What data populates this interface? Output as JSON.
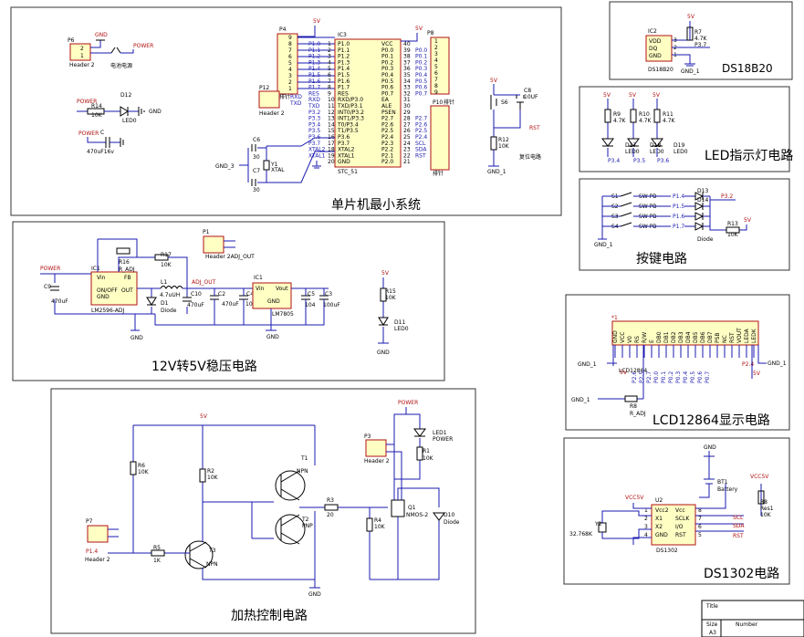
{
  "sections": {
    "mcu": "单片机最小系统",
    "reg": "12V转5V稳压电路",
    "heat": "加热控制电路",
    "ds18": "DS18B20",
    "led": "LED指示灯电路",
    "key": "按键电路",
    "lcd": "LCD12864显示电路",
    "rtc": "DS1302电路"
  },
  "power": {
    "conn": "P6",
    "hdr": "Header 2",
    "gnd": "GND",
    "pwr": "POWER",
    "sw": "电池电源",
    "r": "R14",
    "rv": "10K",
    "led": "D12",
    "ledv": "LED0",
    "cap": "470uF16v",
    "p1": "2",
    "p2": "1"
  },
  "mcu": {
    "ic": "IC3",
    "part": "STC_51",
    "left_names": [
      "P1.0",
      "P1.1",
      "P1.2",
      "P1.3",
      "P1.4",
      "P1.5",
      "P1.6",
      "P1.7",
      "RES",
      "RXD/P3.0",
      "TXD/P3.1",
      "INT0/P3.2",
      "INT1/P3.3",
      "T0/P3.4",
      "T1/P3.5",
      "P3.6",
      "P3.7",
      "XTAL2",
      "XTAL1",
      "GND"
    ],
    "left_pins": [
      "1",
      "2",
      "3",
      "4",
      "5",
      "6",
      "7",
      "8",
      "9",
      "10",
      "11",
      "12",
      "13",
      "14",
      "15",
      "16",
      "17",
      "18",
      "19",
      "20"
    ],
    "left_nets": [
      "P1.0",
      "P1.1",
      "P1.2",
      "P1.3",
      "P1.4",
      "P1.5",
      "P1.6",
      "P1.7",
      "RES",
      "RXD",
      "TXD",
      "P3.2",
      "P3.3",
      "P3.4",
      "P3.5",
      "P3.6",
      "P3.7",
      "XTAL2",
      "XTAL1"
    ],
    "right_names": [
      "VCC",
      "P0.0",
      "P0.1",
      "P0.2",
      "P0.3",
      "P0.4",
      "P0.5",
      "P0.6",
      "P0.7",
      "EA",
      "ALE",
      "PSEN",
      "P2.7",
      "P2.6",
      "P2.5",
      "P2.4",
      "P2.3",
      "P2.2",
      "P2.1",
      "P2.0"
    ],
    "right_pins": [
      "40",
      "39",
      "38",
      "37",
      "36",
      "35",
      "34",
      "33",
      "32",
      "31",
      "30",
      "29",
      "28",
      "27",
      "26",
      "25",
      "24",
      "23",
      "22",
      "21"
    ],
    "right_nets": [
      "P0.0",
      "P0.1",
      "P0.2",
      "P0.3",
      "P0.4",
      "P0.5",
      "P0.6",
      "P0.7",
      "P2.7",
      "P2.6",
      "P2.5",
      "P2.4",
      "SCL",
      "SDA",
      "RST"
    ],
    "p4": "P4",
    "p4_nums": [
      "9",
      "8",
      "7",
      "6",
      "5",
      "4",
      "3",
      "2",
      "1"
    ],
    "p12": "P12",
    "p12_hdr": "Header 2",
    "p12_nets": [
      "RXD",
      "TXD"
    ],
    "p12_lbl": "排针",
    "p8": "P8",
    "p8_nums": [
      "1",
      "2",
      "3",
      "4",
      "5",
      "6",
      "7",
      "8",
      "9"
    ],
    "p10": "P10",
    "p10_lbl": "排针",
    "p10_lbl2": "排针",
    "v5": "5V",
    "c6": "C6",
    "c7": "C7",
    "c30a": "30",
    "c30b": "30",
    "y1": "Y1",
    "xtal": "XTAL",
    "gnd3": "GND_3",
    "s6": "S6",
    "c8": "C8",
    "c8v": "10UF",
    "r12": "R12",
    "r12v": "10K",
    "rst": "RST",
    "gnd1": "GND_1",
    "rstlbl": "复位电路"
  },
  "ds18": {
    "ic": "IC2",
    "pins": [
      "VDD",
      "DQ",
      "GND"
    ],
    "pnum": [
      "3",
      "2",
      "1"
    ],
    "r": "R7",
    "rv": "4.7K",
    "net": "P3.7",
    "v": "5V",
    "part": "DS18B20",
    "gnd": "GND_1"
  },
  "leds": {
    "r": [
      "R9",
      "R10",
      "R11"
    ],
    "rv": [
      "4.7K",
      "4.7K",
      "4.7K"
    ],
    "v": "5V",
    "d": [
      "D17",
      "D18",
      "D19"
    ],
    "dv": [
      "LED0",
      "LED0",
      "LED0"
    ],
    "nets": [
      "P3.4",
      "P3.5",
      "P3.6"
    ]
  },
  "keys": {
    "s": [
      "S1",
      "S2",
      "S3",
      "S4"
    ],
    "sv": "SW-PB",
    "nets": [
      "P1.4",
      "P1.5",
      "P1.6",
      "P1.7"
    ],
    "d13": "D13",
    "d14": "D14",
    "dv": "Diode",
    "p32": "P3.2",
    "r13": "R13",
    "r13v": "10K",
    "v": "5V",
    "gnd": "GND_1"
  },
  "lcd": {
    "star": "*1",
    "pins": [
      "GND",
      "VCC",
      "V0",
      "RS",
      "R/W",
      "E",
      "DB0",
      "DB1",
      "DB2",
      "DB3",
      "DB4",
      "DB5",
      "DB6",
      "DB7",
      "PSB",
      "NC",
      "RST",
      "VOUT",
      "LEDA",
      "LEDK"
    ],
    "nets": [
      "P2.6",
      "P2.5",
      "P2.7",
      "P0.0",
      "P0.1",
      "P0.2",
      "P0.3",
      "P0.4",
      "P0.5",
      "P0.6",
      "P0.7"
    ],
    "lcdlbl": "LCD12864",
    "v5": "5V",
    "gnd": "GND_1",
    "r8": "R8",
    "radj": "R_ADJ",
    "p24": "P2.4",
    "psb": "PSB",
    "rst": "RST",
    "nc": "NC"
  },
  "rtc": {
    "gnd": "GND",
    "bt": "BT1",
    "btv": "Battery",
    "vcc": "VCC5V",
    "pins_l": [
      "Vcc2",
      "X1",
      "X2",
      "GND"
    ],
    "pins_r": [
      "Vcc",
      "SCLK",
      "I/O",
      "RST"
    ],
    "pnum_l": [
      "1",
      "2",
      "3",
      "4"
    ],
    "pnum_r": [
      "8",
      "7",
      "6",
      "5"
    ],
    "nets": [
      "SCL",
      "SDA",
      "RST"
    ],
    "part": "DS1302",
    "ic": "U2",
    "y2": "Y2",
    "y2v": "32.768K",
    "r8": "R8",
    "r8v": "Res1",
    "r8k": "10K",
    "vcc2": "VCC5V"
  },
  "reg": {
    "pwr": "POWER",
    "c9": "C9",
    "c9v": "470uF",
    "ic": "IC1",
    "part": "LM2596-ADJ",
    "pins_l": [
      "Vin",
      "ON/OFF",
      "GND"
    ],
    "pins_r": [
      "FB",
      "OUT"
    ],
    "r16": "R16",
    "radj": "R_ADJ",
    "r17": "R17",
    "r17v": "10K",
    "l1": "L1",
    "l1v": "4.7uUH",
    "d1": "D1",
    "d1v": "Diode",
    "c10": "C10",
    "c10v": "470uF",
    "adj": "ADJ_OUT",
    "p1": "P1",
    "p1h": "Header 2ADJ_OUT",
    "c2": "C2",
    "c2v": "470uF",
    "c4": "C4",
    "c4v": "104",
    "ic2": "IC1",
    "vin": "Vin",
    "vout": "Vout",
    "gnd": "GND",
    "part2": "LM7805",
    "c5": "C5",
    "c5v": "104",
    "c3": "C3",
    "c3v": "100uF",
    "r15": "R15",
    "r15v": "10K",
    "d11": "D11",
    "d11v": "LED0",
    "v": "5V"
  },
  "heat": {
    "v": "5V",
    "r6": "R6",
    "r6v": "10K",
    "r2": "R2",
    "r2v": "10K",
    "t1": "T1",
    "npn": "NPN",
    "t2": "T2",
    "pnp": "PNP",
    "t3": "T3",
    "npn3": "NPN",
    "r3": "R3",
    "r3v": "20",
    "r4": "R4",
    "r4v": "10K",
    "pwr": "POWER",
    "led1": "LED1",
    "led1v": "POWER",
    "r1": "R1",
    "r1v": "10K",
    "p3": "P3",
    "p3h": "Header 2",
    "q1": "Q1",
    "q1v": "NMOS-2",
    "d10": "D10",
    "d10v": "Diode",
    "p7": "P7",
    "p7h": "Header 2",
    "p7net": "P1.4",
    "r5": "R5",
    "r5v": "1K",
    "gnd": "GND"
  },
  "titleblock": {
    "title": "Title",
    "size": "Size",
    "sizev": "A3",
    "number": "Number"
  }
}
